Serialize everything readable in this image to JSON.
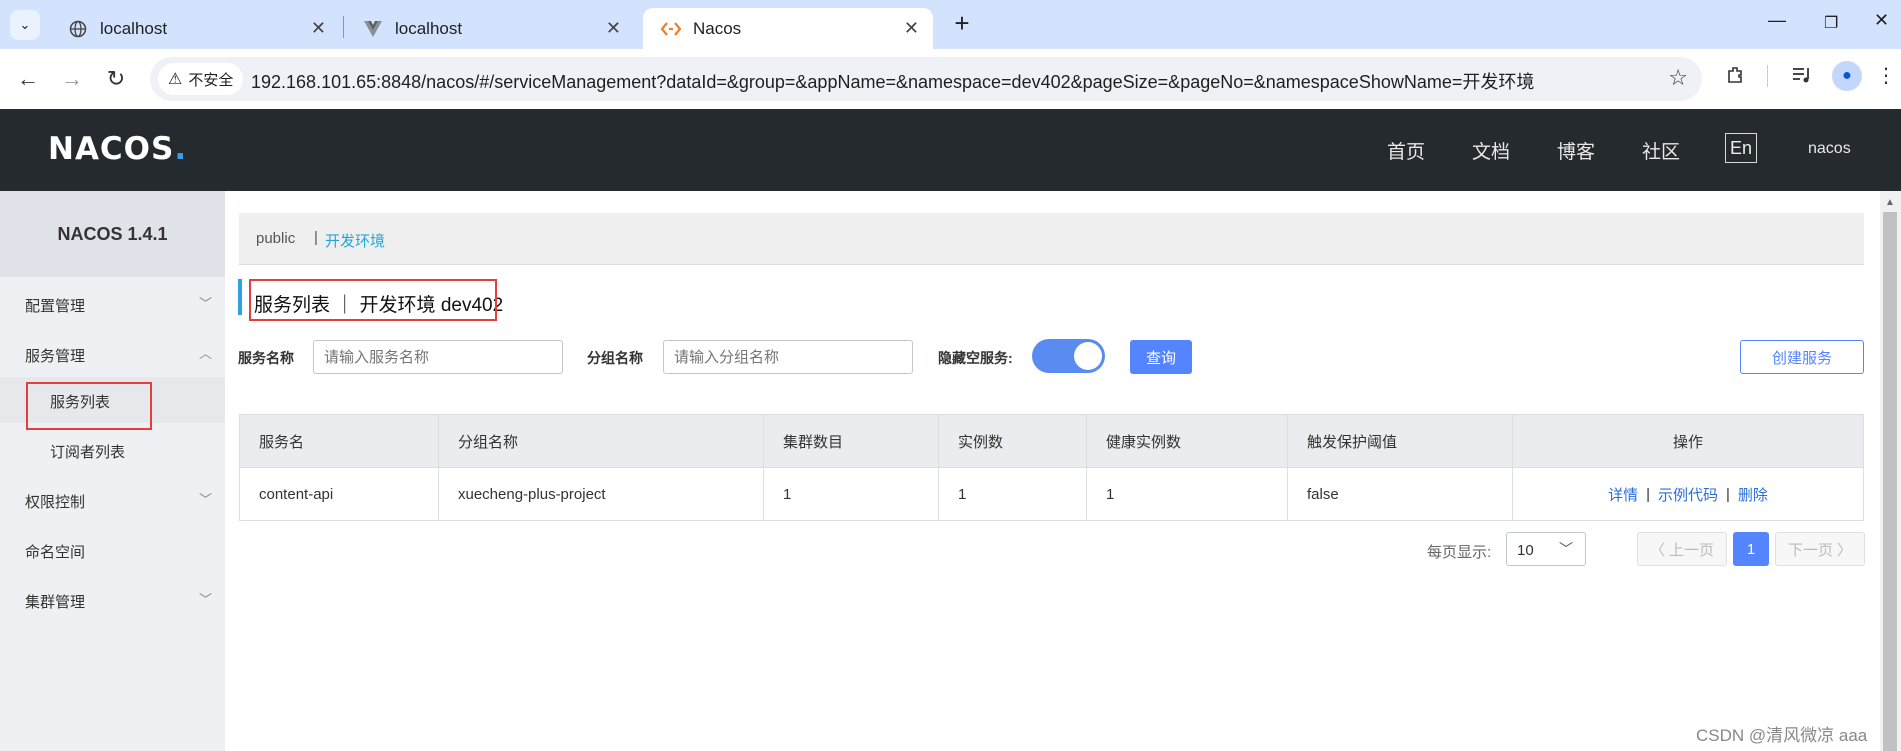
{
  "browser": {
    "tabs": [
      {
        "title": "localhost",
        "icon": "globe-icon"
      },
      {
        "title": "localhost",
        "icon": "vue-icon"
      },
      {
        "title": "Nacos",
        "icon": "nacos-icon",
        "active": true
      }
    ],
    "security_label": "不安全",
    "url": "192.168.101.65:8848/nacos/#/serviceManagement?dataId=&group=&appName=&namespace=dev402&pageSize=&pageNo=&namespaceShowName=开发环境"
  },
  "header": {
    "logo": "NACOS",
    "nav": [
      "首页",
      "文档",
      "博客",
      "社区"
    ],
    "lang": "En",
    "user": "nacos"
  },
  "sidebar": {
    "version": "NACOS 1.4.1",
    "items": [
      {
        "label": "配置管理",
        "chevron": "down"
      },
      {
        "label": "服务管理",
        "chevron": "up"
      },
      {
        "label": "服务列表",
        "sub": true,
        "active": true
      },
      {
        "label": "订阅者列表",
        "sub": true
      },
      {
        "label": "权限控制",
        "chevron": "down"
      },
      {
        "label": "命名空间"
      },
      {
        "label": "集群管理",
        "chevron": "down"
      }
    ]
  },
  "namespaces": {
    "public": "public",
    "separator": "|",
    "current": "开发环境"
  },
  "page": {
    "title": "服务列表 ｜ 开发环境  dev402"
  },
  "filters": {
    "service_name_label": "服务名称",
    "service_name_placeholder": "请输入服务名称",
    "group_name_label": "分组名称",
    "group_name_placeholder": "请输入分组名称",
    "hide_empty_label": "隐藏空服务:",
    "hide_empty_on": true,
    "query_button": "查询",
    "create_button": "创建服务"
  },
  "table": {
    "columns": [
      "服务名",
      "分组名称",
      "集群数目",
      "实例数",
      "健康实例数",
      "触发保护阈值",
      "操作"
    ],
    "rows": [
      {
        "cells": [
          "content-api",
          "xuecheng-plus-project",
          "1",
          "1",
          "1",
          "false"
        ],
        "actions": [
          "详情",
          "示例代码",
          "删除"
        ]
      }
    ]
  },
  "pagination": {
    "page_size_label": "每页显示:",
    "page_size": "10",
    "prev": "上一页",
    "current": "1",
    "next": "下一页"
  },
  "watermark": "CSDN @清风微凉 aaa",
  "colors": {
    "header_bg": "#252a2f",
    "primary": "#5584ff",
    "namespace_active": "#26a6d6",
    "highlight_box": "#e63d3d"
  }
}
